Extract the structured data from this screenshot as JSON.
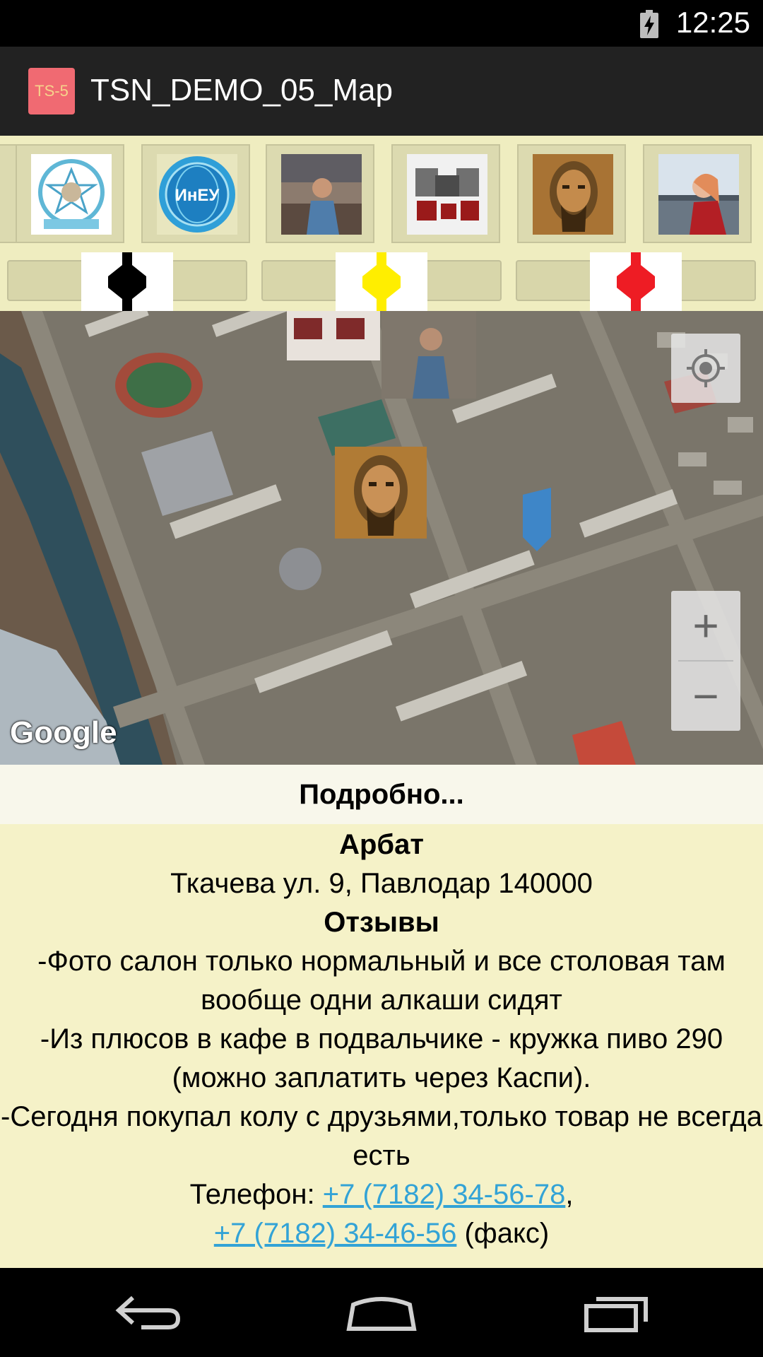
{
  "status_bar": {
    "time": "12:25",
    "battery_icon": "battery-charging-icon"
  },
  "app": {
    "icon_text": "TS-5",
    "title": "TSN_DEMO_05_Map"
  },
  "thumbnails": [
    {
      "icon": "logo-university-icon"
    },
    {
      "icon": "logo-ineu-icon"
    },
    {
      "icon": "photo-woman-icon"
    },
    {
      "icon": "photo-pattern-icon"
    },
    {
      "icon": "photo-painting-icon"
    },
    {
      "icon": "photo-woman-river-icon"
    }
  ],
  "markers": [
    {
      "icon": "black-marker-icon",
      "color": "#000000"
    },
    {
      "icon": "yellow-marker-icon",
      "color": "#ffee00"
    },
    {
      "icon": "red-marker-icon",
      "color": "#ee1c24"
    }
  ],
  "map": {
    "google_label": "Google",
    "zoom_in": "+",
    "zoom_out": "−"
  },
  "details": {
    "more_label": "Подробно...",
    "place_name": "Арбат",
    "address": "Ткачева ул. 9, Павлодар 140000",
    "reviews_title": "Отзывы",
    "review_1": "-Фото салон только нормальный и все столовая там вообще одни алкаши сидят",
    "review_2": "-Из плюсов в кафе в подвальчике - кружка пиво 290 (можно заплатить через Каспи).",
    "review_3": "-Сегодня покупал колу с друзьями,только товар не всегда есть",
    "phone_label": "Телефон: ",
    "phone_1": "+7 (7182) 34-56-78",
    "phone_sep": ",",
    "phone_2": "+7 (7182) 34-46-56",
    "fax_label": " (факс)"
  },
  "navbar": {
    "back": "back-icon",
    "home": "home-icon",
    "recents": "recents-icon"
  }
}
